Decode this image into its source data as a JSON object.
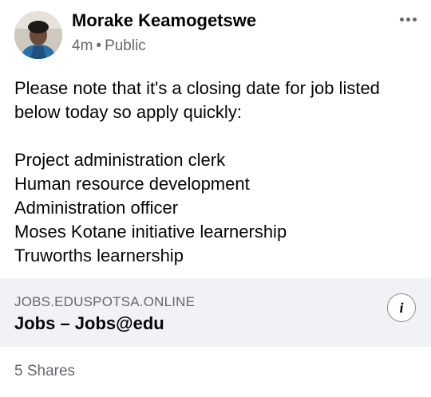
{
  "post": {
    "author": "Morake Keamogetswe",
    "time": "4m",
    "separator": "•",
    "privacy": "Public",
    "intro": "Please note that it's a closing date for job listed below today so apply quickly:",
    "jobs": [
      "Project administration clerk",
      "Human resource development",
      "Administration officer",
      "Moses Kotane initiative learnership",
      "Truworths learnership"
    ]
  },
  "link_preview": {
    "domain": "JOBS.EDUSPOTSA.ONLINE",
    "title": "Jobs – Jobs@edu",
    "info_icon_glyph": "i"
  },
  "footer": {
    "shares": "5 Shares"
  },
  "icons": {
    "more": "more-horizontal-icon",
    "info": "info-icon"
  },
  "colors": {
    "text_primary": "#050505",
    "text_secondary": "#65676b",
    "card_background": "#f0f2f5"
  }
}
